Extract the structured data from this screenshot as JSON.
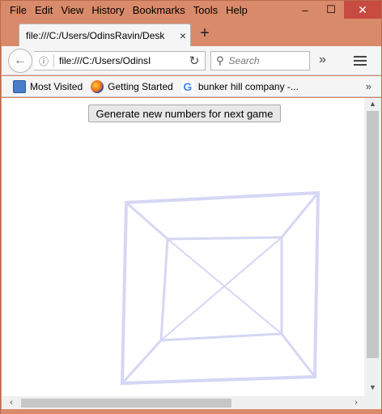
{
  "menubar": {
    "items": [
      "File",
      "Edit",
      "View",
      "History",
      "Bookmarks",
      "Tools",
      "Help"
    ]
  },
  "window_controls": {
    "minimize": "–",
    "maximize": "☐",
    "close": "✕"
  },
  "tab": {
    "title": "file:///C:/Users/OdinsRavin/Desk",
    "close": "×"
  },
  "new_tab": "+",
  "navbar": {
    "url": "file:///C:/Users/OdinsI",
    "search_placeholder": "Search",
    "overflow": "»"
  },
  "bookmarks": {
    "items": [
      {
        "label": "Most Visited",
        "icon": "most-visited-icon"
      },
      {
        "label": "Getting Started",
        "icon": "firefox-icon"
      },
      {
        "label": "bunker hill company -...",
        "icon": "google-icon"
      }
    ],
    "more": "»"
  },
  "content": {
    "button_label": "Generate new numbers for next game"
  },
  "colors": {
    "titlebar": "#d98a6a",
    "close_button": "#c84a40",
    "line_color": "#d6d6f5"
  }
}
